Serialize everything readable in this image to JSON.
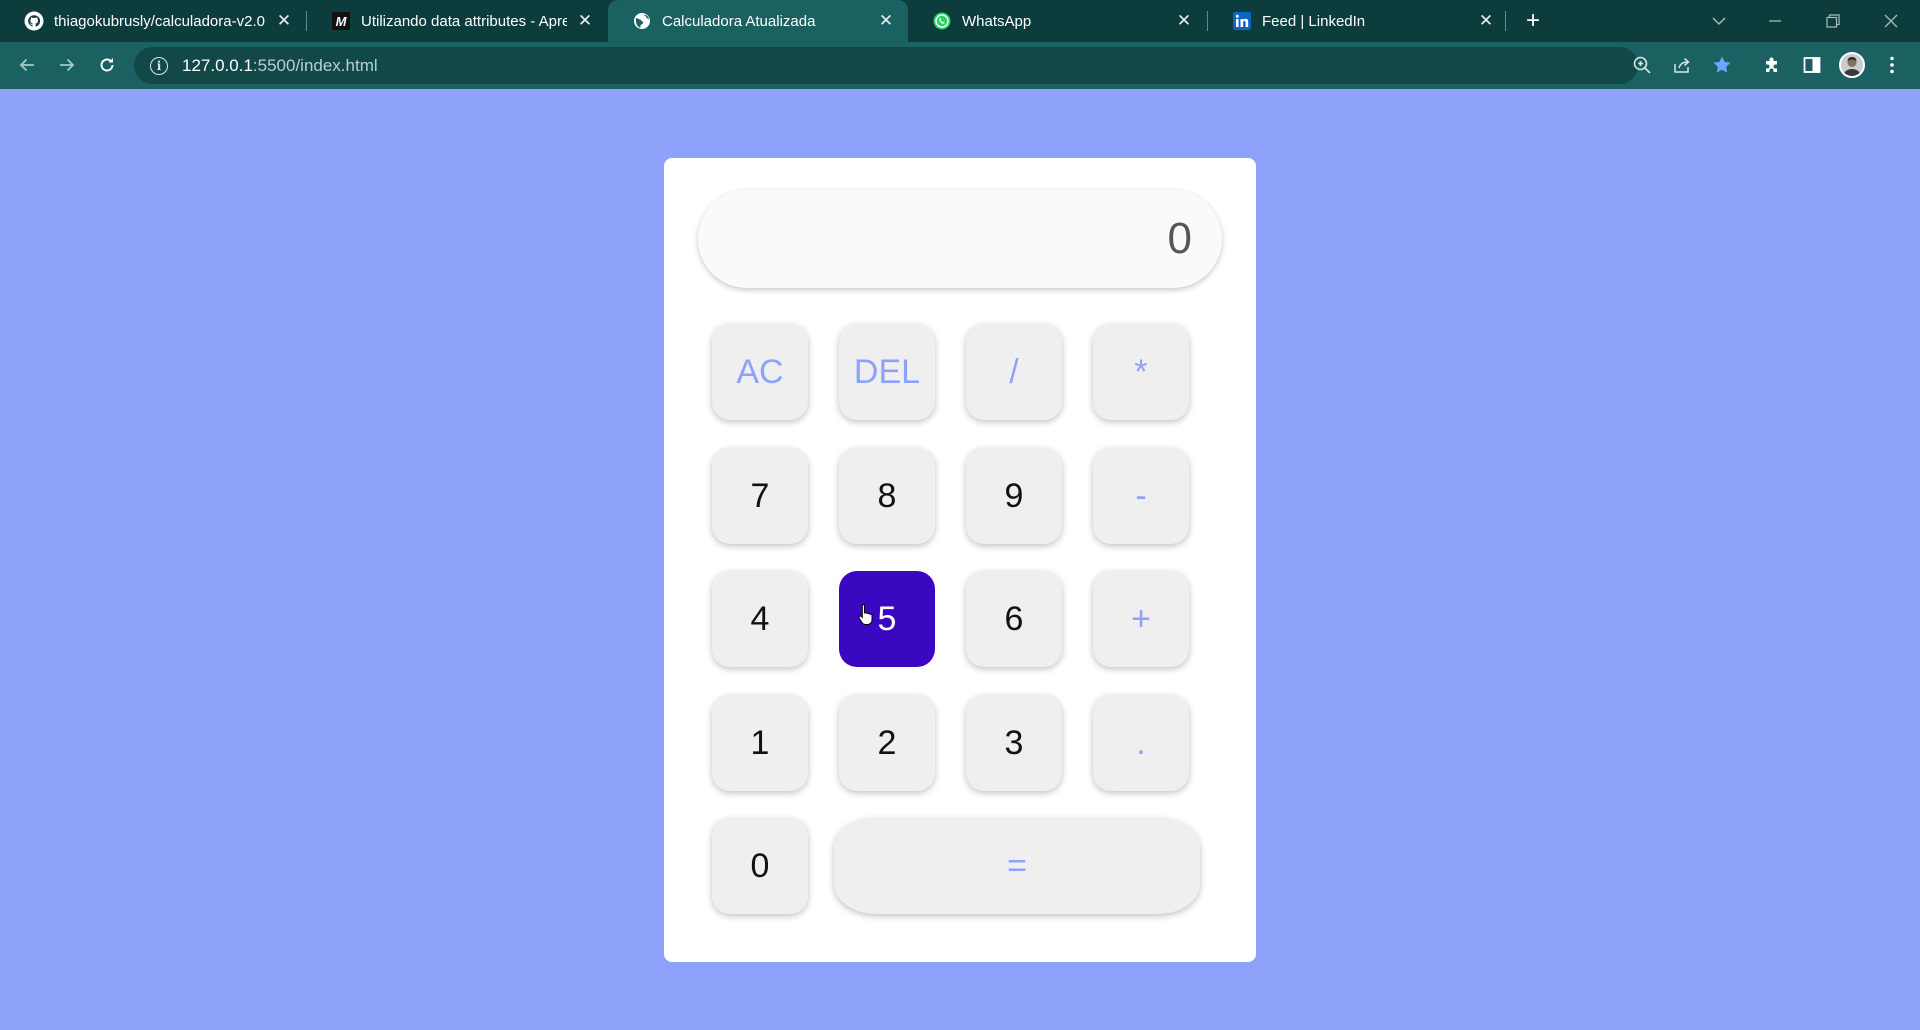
{
  "browser": {
    "tabs": [
      {
        "title": "thiagokubrusly/calculadora-v2.0",
        "icon": "github-icon"
      },
      {
        "title": "Utilizando data attributes - Aprender",
        "icon": "medium-icon"
      },
      {
        "title": "Calculadora Atualizada",
        "icon": "globe-icon",
        "active": true
      },
      {
        "title": "WhatsApp",
        "icon": "whatsapp-icon"
      },
      {
        "title": "Feed | LinkedIn",
        "icon": "linkedin-icon"
      }
    ],
    "close_glyph": "✕",
    "new_tab_glyph": "+",
    "address": {
      "host": "127.0.0.1",
      "rest": ":5500/index.html"
    },
    "colors": {
      "tabstrip": "#0c3c3c",
      "toolbar": "#1b6161",
      "page_bg": "#8fa2fb"
    }
  },
  "calculator": {
    "display_value": "0",
    "keys": {
      "ac": "AC",
      "del": "DEL",
      "divide": "/",
      "multiply": "*",
      "seven": "7",
      "eight": "8",
      "nine": "9",
      "minus": "-",
      "four": "4",
      "five": "5",
      "six": "6",
      "plus": "+",
      "one": "1",
      "two": "2",
      "three": "3",
      "dot": ".",
      "zero": "0",
      "equals": "="
    },
    "pressed_key": "5",
    "colors": {
      "operator": "#8fa2fb",
      "pressed": "#3a08c1",
      "key_bg": "#efefef"
    }
  }
}
